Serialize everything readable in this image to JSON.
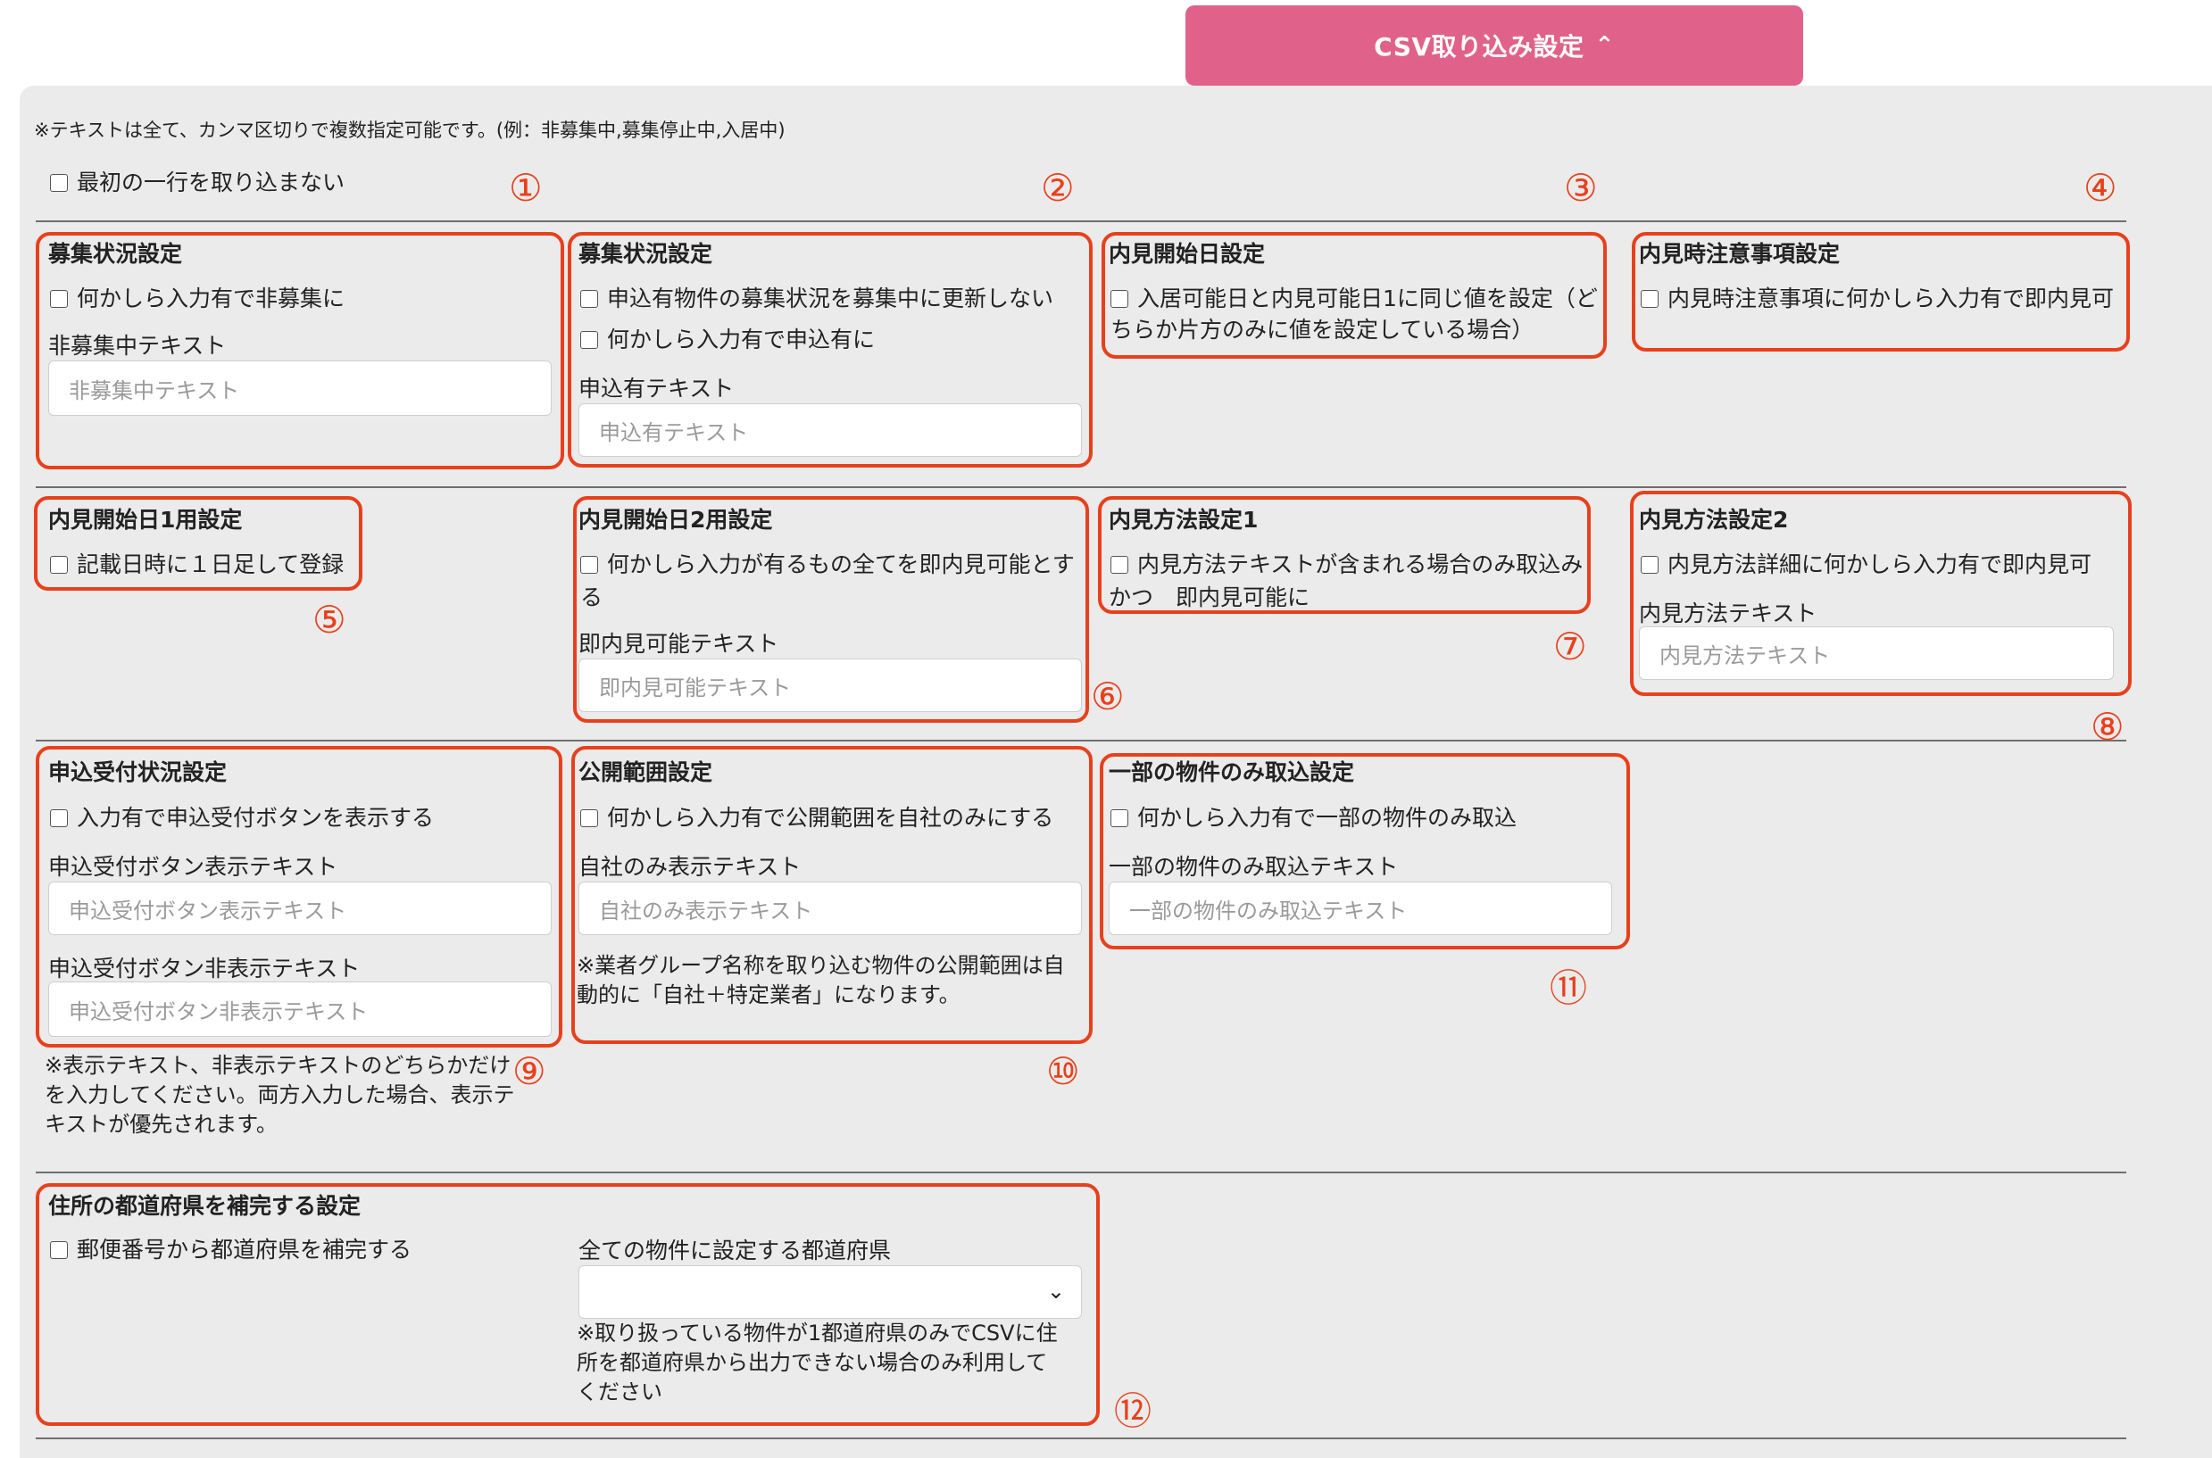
{
  "header": {
    "csv_button_label": "CSV取り込み設定",
    "csv_button_icon": "chevron-up-icon",
    "accent_color": "#e0628a"
  },
  "note_top": "※テキストは全て、カンマ区切りで複数指定可能です。(例：非募集中,募集停止中,入居中)",
  "skip_first_row_label": "最初の一行を取り込まない",
  "annotation_color": "#e8401c",
  "sections": {
    "s1": {
      "number": "①",
      "title": "募集状況設定",
      "checkbox": "何かしら入力有で非募集に",
      "field_label": "非募集中テキスト",
      "placeholder": "非募集中テキスト"
    },
    "s2": {
      "number": "②",
      "title": "募集状況設定",
      "checkbox1": "申込有物件の募集状況を募集中に更新しない",
      "checkbox2": "何かしら入力有で申込有に",
      "field_label": "申込有テキスト",
      "placeholder": "申込有テキスト"
    },
    "s3": {
      "number": "③",
      "title": "内見開始日設定",
      "checkbox_line1": "入居可能日と内見可能日1に同じ値を設定（ど",
      "checkbox_line2": "ちらか片方のみに値を設定している場合）"
    },
    "s4": {
      "number": "④",
      "title": "内見時注意事項設定",
      "checkbox": "内見時注意事項に何かしら入力有で即内見可"
    },
    "s5": {
      "number": "⑤",
      "title": "内見開始日1用設定",
      "checkbox": "記載日時に１日足して登録"
    },
    "s6": {
      "number": "⑥",
      "title": "内見開始日2用設定",
      "checkbox_line1": "何かしら入力が有るもの全てを即内見可能とす",
      "checkbox_line2": "る",
      "field_label": "即内見可能テキスト",
      "placeholder": "即内見可能テキスト"
    },
    "s7": {
      "number": "⑦",
      "title": "内見方法設定1",
      "checkbox_line1": "内見方法テキストが含まれる場合のみ取込み",
      "checkbox_line2": "かつ　即内見可能に"
    },
    "s8": {
      "number": "⑧",
      "title": "内見方法設定2",
      "checkbox": "内見方法詳細に何かしら入力有で即内見可",
      "field_label": "内見方法テキスト",
      "placeholder": "内見方法テキスト"
    },
    "s9": {
      "number": "⑨",
      "title": "申込受付状況設定",
      "checkbox": "入力有で申込受付ボタンを表示する",
      "field1_label": "申込受付ボタン表示テキスト",
      "placeholder1": "申込受付ボタン表示テキスト",
      "field2_label": "申込受付ボタン非表示テキスト",
      "placeholder2": "申込受付ボタン非表示テキスト",
      "note_line1": "※表示テキスト、非表示テキストのどちらかだけ",
      "note_line2": "を入力してください。両方入力した場合、表示テ",
      "note_line3": "キストが優先されます。"
    },
    "s10": {
      "number": "⑩",
      "title": "公開範囲設定",
      "checkbox": "何かしら入力有で公開範囲を自社のみにする",
      "field_label": "自社のみ表示テキスト",
      "placeholder": "自社のみ表示テキスト",
      "note_line1": "※業者グループ名称を取り込む物件の公開範囲は自",
      "note_line2": "動的に「自社＋特定業者」になります。"
    },
    "s11": {
      "number": "⑪",
      "title": "一部の物件のみ取込設定",
      "checkbox": "何かしら入力有で一部の物件のみ取込",
      "field_label": "一部の物件のみ取込テキスト",
      "placeholder": "一部の物件のみ取込テキスト"
    },
    "s12": {
      "number": "⑫",
      "title": "住所の都道府県を補完する設定",
      "checkbox": "郵便番号から都道府県を補完する",
      "select_label": "全ての物件に設定する都道府県",
      "select_value": "",
      "note_line1": "※取り扱っている物件が1都道府県のみでCSVに住",
      "note_line2": "所を都道府県から出力できない場合のみ利用して",
      "note_line3": "ください"
    }
  }
}
